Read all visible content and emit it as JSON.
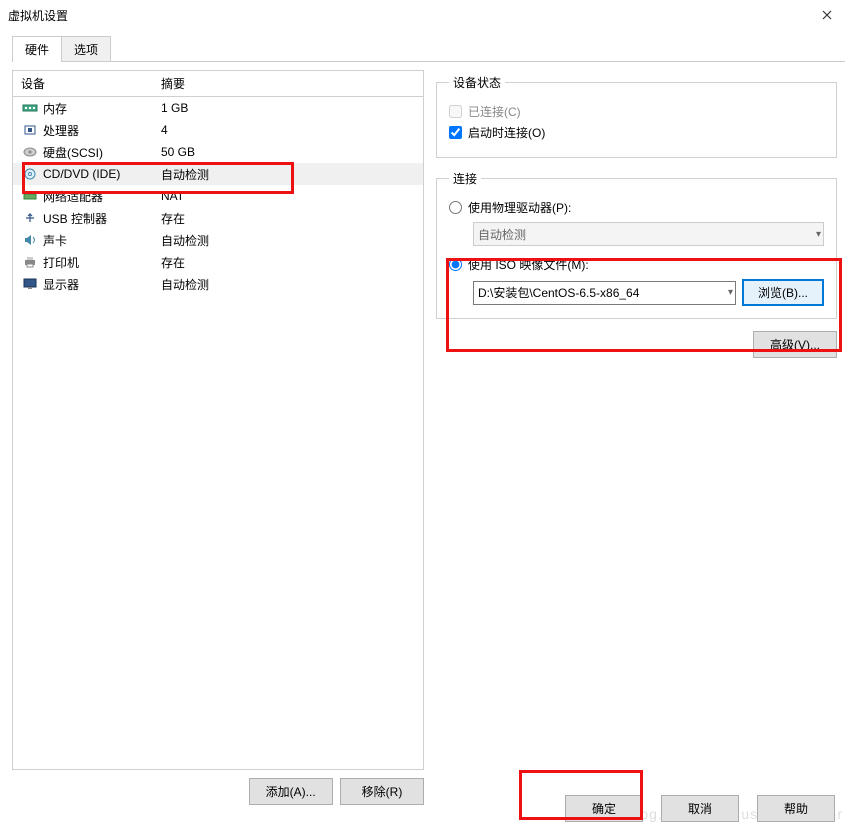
{
  "window": {
    "title": "虚拟机设置"
  },
  "tabs": {
    "hardware": "硬件",
    "options": "选项"
  },
  "headers": {
    "device": "设备",
    "summary": "摘要"
  },
  "devices": [
    {
      "name": "内存",
      "summary": "1 GB"
    },
    {
      "name": "处理器",
      "summary": "4"
    },
    {
      "name": "硬盘(SCSI)",
      "summary": "50 GB"
    },
    {
      "name": "CD/DVD (IDE)",
      "summary": "自动检测"
    },
    {
      "name": "网络适配器",
      "summary": "NAT"
    },
    {
      "name": "USB 控制器",
      "summary": "存在"
    },
    {
      "name": "声卡",
      "summary": "自动检测"
    },
    {
      "name": "打印机",
      "summary": "存在"
    },
    {
      "name": "显示器",
      "summary": "自动检测"
    }
  ],
  "left_buttons": {
    "add": "添加(A)...",
    "remove": "移除(R)"
  },
  "status": {
    "legend": "设备状态",
    "connected": "已连接(C)",
    "connect_on": "启动时连接(O)"
  },
  "connection": {
    "legend": "连接",
    "physical": "使用物理驱动器(P):",
    "physical_value": "自动检测",
    "iso": "使用 ISO 映像文件(M):",
    "iso_path": "D:\\安装包\\CentOS-6.5-x86_64",
    "browse": "浏览(B)..."
  },
  "advanced": "高级(V)...",
  "footer": {
    "ok": "确定",
    "cancel": "取消",
    "help": "帮助"
  },
  "watermark": "http://blog.csdn.net/MusicEnchanter"
}
